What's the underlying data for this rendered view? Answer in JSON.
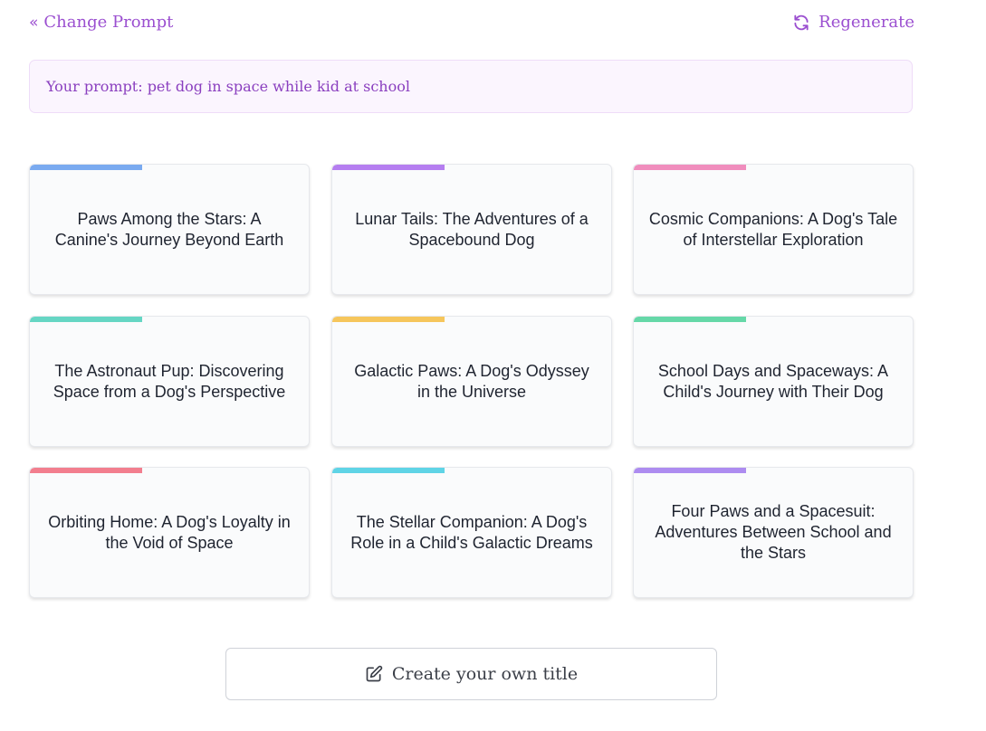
{
  "nav": {
    "change_prompt_chevron": "«",
    "change_prompt_label": "Change Prompt",
    "regenerate_label": "Regenerate",
    "accent_color": "#9b4fd0"
  },
  "prompt": {
    "text": "Your prompt: pet dog in space while kid at school"
  },
  "titles": [
    {
      "text": "Paws Among the Stars: A Canine's Journey Beyond Earth",
      "accent": "#7aaaf0"
    },
    {
      "text": "Lunar Tails: The Adventures of a Spacebound Dog",
      "accent": "#b57ef0"
    },
    {
      "text": "Cosmic Companions: A Dog's Tale of Interstellar Exploration",
      "accent": "#f08dbd"
    },
    {
      "text": "The Astronaut Pup: Discovering Space from a Dog's Perspective",
      "accent": "#66d6c4"
    },
    {
      "text": "Galactic Paws: A Dog's Odyssey in the Universe",
      "accent": "#f6c65c"
    },
    {
      "text": "School Days and Spaceways: A Child's Journey with Their Dog",
      "accent": "#66d8a8"
    },
    {
      "text": "Orbiting Home: A Dog's Loyalty in the Void of Space",
      "accent": "#f27e8e"
    },
    {
      "text": "The Stellar Companion: A Dog's Role in a Child's Galactic Dreams",
      "accent": "#5fd4e6"
    },
    {
      "text": "Four Paws and a Spacesuit: Adventures Between School and the Stars",
      "accent": "#ad8cf0"
    }
  ],
  "create": {
    "label": "Create your own title",
    "icon": "edit-icon"
  }
}
